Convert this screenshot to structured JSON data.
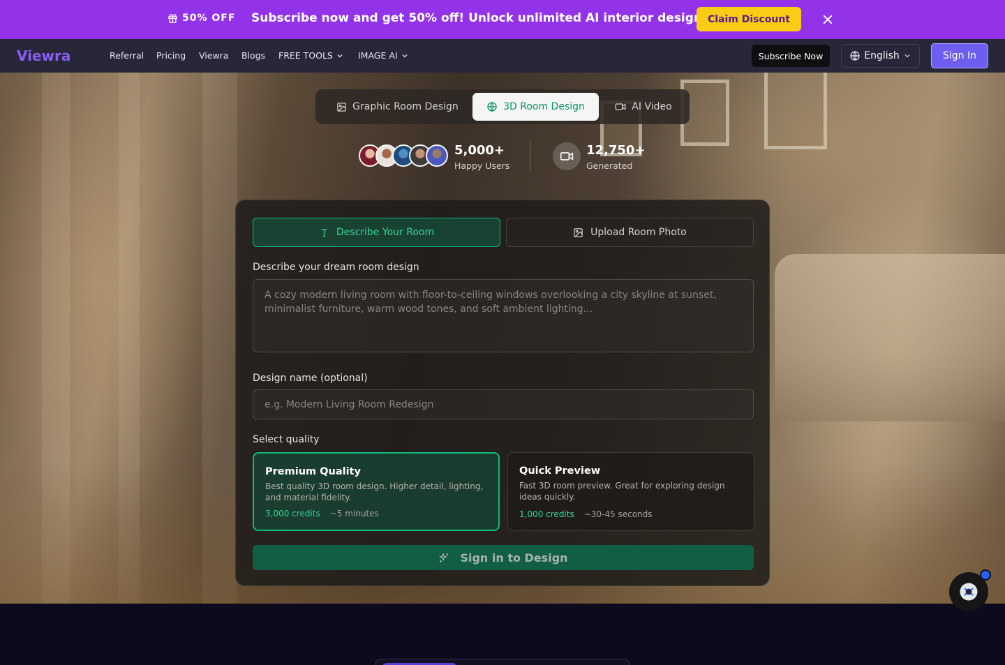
{
  "promo": {
    "badge": "50% OFF",
    "badge_icon": "gift-icon",
    "text": "Subscribe now and get 50% off! Unlock unlimited AI interior design.",
    "cta": "Claim Discount",
    "bg_color": "#9233ea",
    "cta_color": "#facc15"
  },
  "nav": {
    "logo": "Viewra",
    "links": [
      "Referral",
      "Pricing",
      "Viewra",
      "Blogs",
      "FREE TOOLS",
      "IMAGE AI"
    ],
    "subscribe": "Subscribe Now",
    "language": "English",
    "sign_in": "Sign In",
    "accent_color": "#8b5cf6"
  },
  "modes": {
    "tabs": [
      {
        "label": "Graphic Room Design",
        "icon": "image-icon"
      },
      {
        "label": "3D Room Design",
        "icon": "globe-icon"
      },
      {
        "label": "AI Video",
        "icon": "video-icon"
      }
    ],
    "selected": "3D Room Design"
  },
  "stats": {
    "users_value": "5,000+",
    "users_label": "Happy Users",
    "generated_value": "12,750+",
    "generated_label": "Generated"
  },
  "form": {
    "input_tabs": [
      "Describe Your Room",
      "Upload Room Photo"
    ],
    "selected_input_tab": "Describe Your Room",
    "describe_label": "Describe your dream room design",
    "describe_placeholder": "A cozy modern living room with floor-to-ceiling windows overlooking a city skyline at sunset, minimalist furniture, warm wood tones, and soft ambient lighting...",
    "name_label": "Design name (optional)",
    "name_placeholder": "e.g. Modern Living Room Redesign",
    "quality_label": "Select quality",
    "qualities": [
      {
        "title": "Premium Quality",
        "desc": "Best quality 3D room design. Higher detail, lighting, and material fidelity.",
        "credits": "3,000 credits",
        "time": "~5 minutes"
      },
      {
        "title": "Quick Preview",
        "desc": "Fast 3D room preview. Great for exploring design ideas quickly.",
        "credits": "1,000 credits",
        "time": "~30-45 seconds"
      }
    ],
    "selected_quality": "Premium Quality",
    "submit": "Sign in to Design",
    "accent_color": "#10b981"
  }
}
